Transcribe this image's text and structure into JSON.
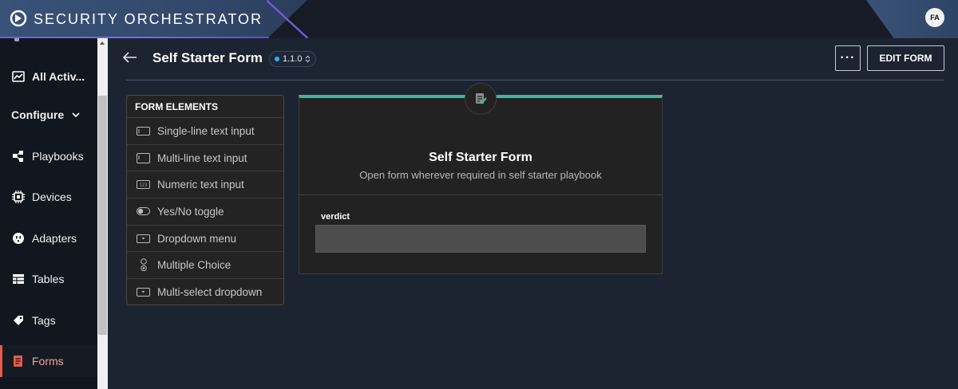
{
  "header": {
    "app_title": "SECURITY ORCHESTRATOR",
    "avatar_initials": "FA",
    "brand_color": "#3a5278",
    "accent_line_color": "#6c5ce7"
  },
  "sidebar": {
    "items": [
      {
        "label": "All Activ...",
        "icon": "activity-chart-icon"
      },
      {
        "label": "Playbooks",
        "icon": "playbooks-icon"
      },
      {
        "label": "Devices",
        "icon": "chip-icon"
      },
      {
        "label": "Adapters",
        "icon": "plug-icon"
      },
      {
        "label": "Tables",
        "icon": "table-icon"
      },
      {
        "label": "Tags",
        "icon": "tag-icon"
      },
      {
        "label": "Forms",
        "icon": "form-icon",
        "active": true
      }
    ],
    "section_label": "Configure",
    "active_color": "#ea5a4a"
  },
  "page": {
    "title": "Self Starter Form",
    "version": "1.1.0",
    "more_label": "···",
    "edit_label": "EDIT FORM"
  },
  "form_elements": {
    "header": "FORM ELEMENTS",
    "items": [
      {
        "label": "Single-line text input",
        "icon": "single-line-input-icon"
      },
      {
        "label": "Multi-line text input",
        "icon": "multi-line-input-icon"
      },
      {
        "label": "Numeric text input",
        "icon": "numeric-input-icon",
        "icon_text": "123"
      },
      {
        "label": "Yes/No toggle",
        "icon": "toggle-icon"
      },
      {
        "label": "Dropdown menu",
        "icon": "dropdown-icon"
      },
      {
        "label": "Multiple Choice",
        "icon": "multiple-choice-icon"
      },
      {
        "label": "Multi-select dropdown",
        "icon": "multi-select-dropdown-icon"
      }
    ]
  },
  "form_preview": {
    "title": "Self Starter Form",
    "description": "Open form wherever required in self starter playbook",
    "field_label": "verdict",
    "field_value": "",
    "accent_color": "#3fb89a"
  }
}
